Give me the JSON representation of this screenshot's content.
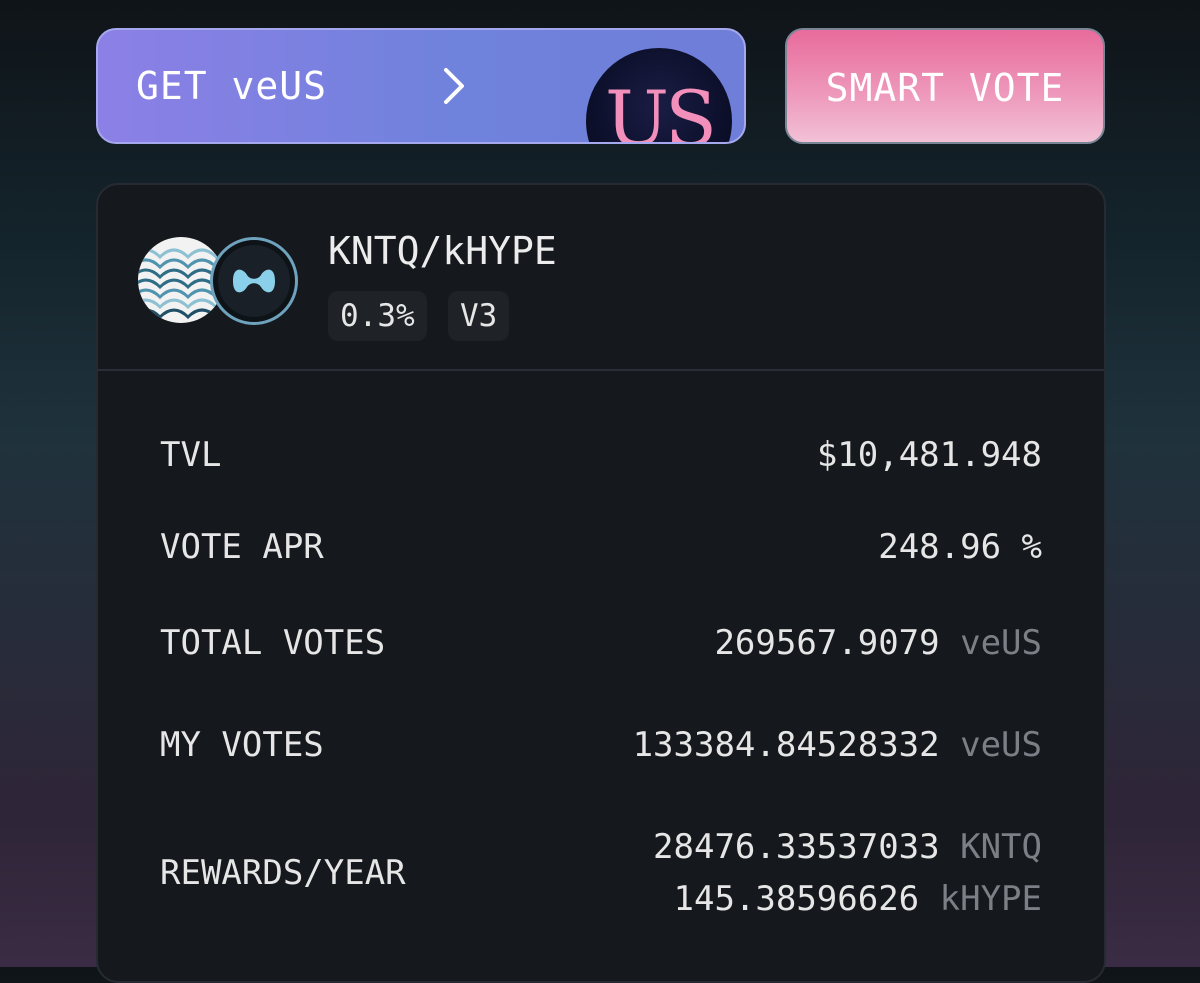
{
  "actions": {
    "get_label": "GET veUS",
    "brand_logo_text": "US",
    "smart_vote_label": "SMART VOTE"
  },
  "pool": {
    "pair": "KNTQ/kHYPE",
    "fee": "0.3%",
    "version": "V3",
    "token_a_icon": "kntq-wave-logo-icon",
    "token_b_icon": "khype-logo-icon"
  },
  "stats": {
    "tvl_label": "TVL",
    "tvl_value": "$10,481.948",
    "apr_label": "VOTE APR",
    "apr_value": "248.96 %",
    "total_votes_label": "TOTAL VOTES",
    "total_votes_value": "269567.9079",
    "total_votes_unit": "veUS",
    "my_votes_label": "MY VOTES",
    "my_votes_value": "133384.84528332",
    "my_votes_unit": "veUS",
    "rewards_label": "REWARDS/YEAR",
    "rewards": [
      {
        "value": "28476.33537033",
        "unit": "KNTQ"
      },
      {
        "value": "145.38596626",
        "unit": "kHYPE"
      }
    ]
  },
  "colors": {
    "get_button": "#6f82dc",
    "smart_vote_button": "#ee9bbd",
    "card_bg": "#15181d",
    "unit_text": "#7b7f86"
  }
}
